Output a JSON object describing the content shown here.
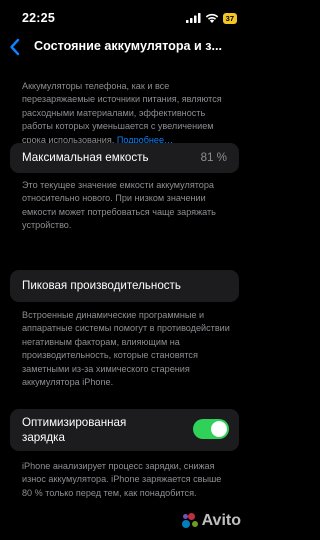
{
  "status_bar": {
    "time": "22:25",
    "battery": "37"
  },
  "nav": {
    "title": "Состояние аккумулятора и з..."
  },
  "intro": {
    "text": "Аккумуляторы телефона, как и все перезаряжаемые источники питания, являются расходными материалами, эффективность работы которых уменьшается с увеличением срока использования.",
    "link": "Подробнее…"
  },
  "capacity": {
    "label": "Максимальная емкость",
    "value": "81 %"
  },
  "capacity_note": "Это текущее значение емкости аккумулятора относительно нового. При низком значении емкости может потребоваться чаще заряжать устройство.",
  "peak": {
    "label": "Пиковая производительность"
  },
  "peak_note": "Встроенные динамические программные и аппаратные системы помогут в противодействии негативным факторам, влияющим на производительность, которые становятся заметными из-за химического старения аккумулятора iPhone.",
  "optimized": {
    "label": "Оптимизированная зарядка",
    "enabled": true
  },
  "optimized_note": "iPhone анализирует процесс зарядки, снижая износ аккумулятора. iPhone заряжается свыше 80 % только перед тем, как понадобится.",
  "watermark": {
    "text": "Avito"
  }
}
